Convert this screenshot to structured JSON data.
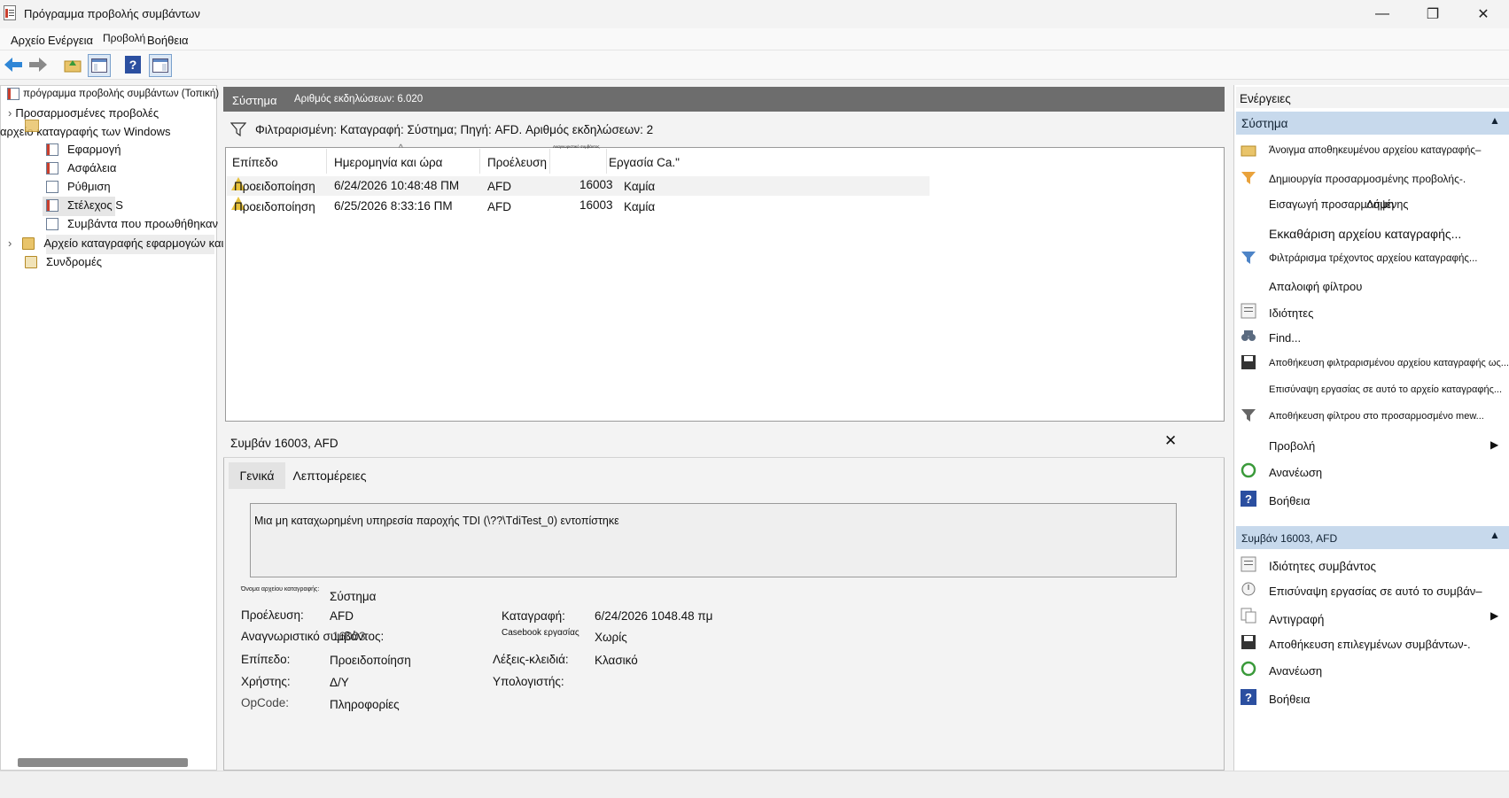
{
  "window": {
    "title": "Πρόγραμμα προβολής συμβάντων"
  },
  "menu": [
    "Αρχείο",
    "Ενέργεια",
    "Προβολή",
    "Βοήθεια"
  ],
  "tree": {
    "root": "πρόγραμμα προβολής συμβάντων (Τοπική)",
    "custom_views": "Προσαρμοσμένες προβολές",
    "windows_logs": "αρχείο καταγραφής των Windows",
    "application": "Εφαρμογή",
    "security": "Ασφάλεια",
    "setup": "Ρύθμιση",
    "system": "Στέλεχος S",
    "forwarded": "Συμβάντα που προωθήθηκαν",
    "app_services": "Αρχείο καταγραφής εφαρμογών και υπηρεσιών",
    "subscriptions": "Συνδρομές"
  },
  "center": {
    "log_name": "Σύστημα",
    "event_count": "Αριθμός εκδηλώσεων: 6.020",
    "filter_text": "Φιλτραρισμένη: Καταγραφή: Σύστημα; Πηγή: AFD. Αριθμός εκδηλώσεων: 2",
    "columns": [
      "Επίπεδο",
      "Ημερομηνία και ώρα",
      "Προέλευση",
      "Αναγνωριστικό συμβάντος",
      "Εργασία Ca.\""
    ],
    "rows": [
      {
        "level": "Προειδοποίηση",
        "datetime": "6/24/2026 10:48:48 ΠΜ",
        "source": "AFD",
        "id": "16003",
        "task": "Καμία"
      },
      {
        "level": "Προειδοποίηση",
        "datetime": "6/25/2026 8:33:16 ΠΜ",
        "source": "AFD",
        "id": "16003",
        "task": "Καμία"
      }
    ]
  },
  "detail": {
    "title": "Συμβάν 16003, AFD",
    "tabs": [
      "Γενικά",
      "Λεπτομέρειες"
    ],
    "description": "Μια μη καταχωρημένη υπηρεσία παροχής TDI (\\??\\TdiTest_0) εντοπίστηκε",
    "log_name_label": "Όνομα αρχείου καταγραφής:",
    "log_name_value": "Σύστημα",
    "source_label": "Προέλευση:",
    "source_value": "AFD",
    "logged_label": "Καταγραφή:",
    "logged_value": "6/24/2026 1048.48 πμ",
    "event_id_label": "Αναγνωριστικό συμβάντος:",
    "event_id_value": "16003",
    "task_label": "Casebook εργασίας",
    "task_value": "Χωρίς",
    "level_label": "Επίπεδο:",
    "level_value": "Προειδοποίηση",
    "keywords_label": "Λέξεις-κλειδιά:",
    "keywords_value": "Κλασικό",
    "user_label": "Χρήστης:",
    "user_value": "Δ/Υ",
    "computer_label": "Υπολογιστής:",
    "opcode_label": "OpCode:",
    "opcode_value": "Πληροφορίες"
  },
  "actions": {
    "header": "Ενέργειες",
    "section1": "Σύστημα",
    "items1": [
      "Άνοιγμα αποθηκευμένου αρχείου καταγραφής–",
      "Δημιουργία προσαρμοσμένης προβολής-.",
      "Εισαγωγή προσαρμοσμένης",
      "Εκκαθάριση αρχείου καταγραφής...",
      "Φιλτράρισμα τρέχοντος αρχείου καταγραφής...",
      "Απαλοιφή φίλτρου",
      "Ιδιότητες",
      "Find...",
      "Αποθήκευση φιλτραρισμένου αρχείου καταγραφής ως...",
      "Επισύναψη εργασίας σε αυτό το αρχείο καταγραφής...",
      "Αποθήκευση φίλτρου στο προσαρμοσμένο mew...",
      "Προβολή",
      "Ανανέωση",
      "Βοήθεια"
    ],
    "overlap_word": "Λήψη",
    "section2": "Συμβάν 16003, AFD",
    "items2": [
      "Ιδιότητες συμβάντος",
      "Επισύναψη εργασίας σε αυτό το συμβάν–",
      "Αντιγραφή",
      "Αποθήκευση επιλεγμένων συμβάντων-.",
      "Ανανέωση",
      "Βοήθεια"
    ]
  },
  "colors": {
    "accent": "#c7d9ec",
    "header_grey": "#6d6d6d",
    "warning": "#e7c23b",
    "help_blue": "#2b4fa0"
  }
}
